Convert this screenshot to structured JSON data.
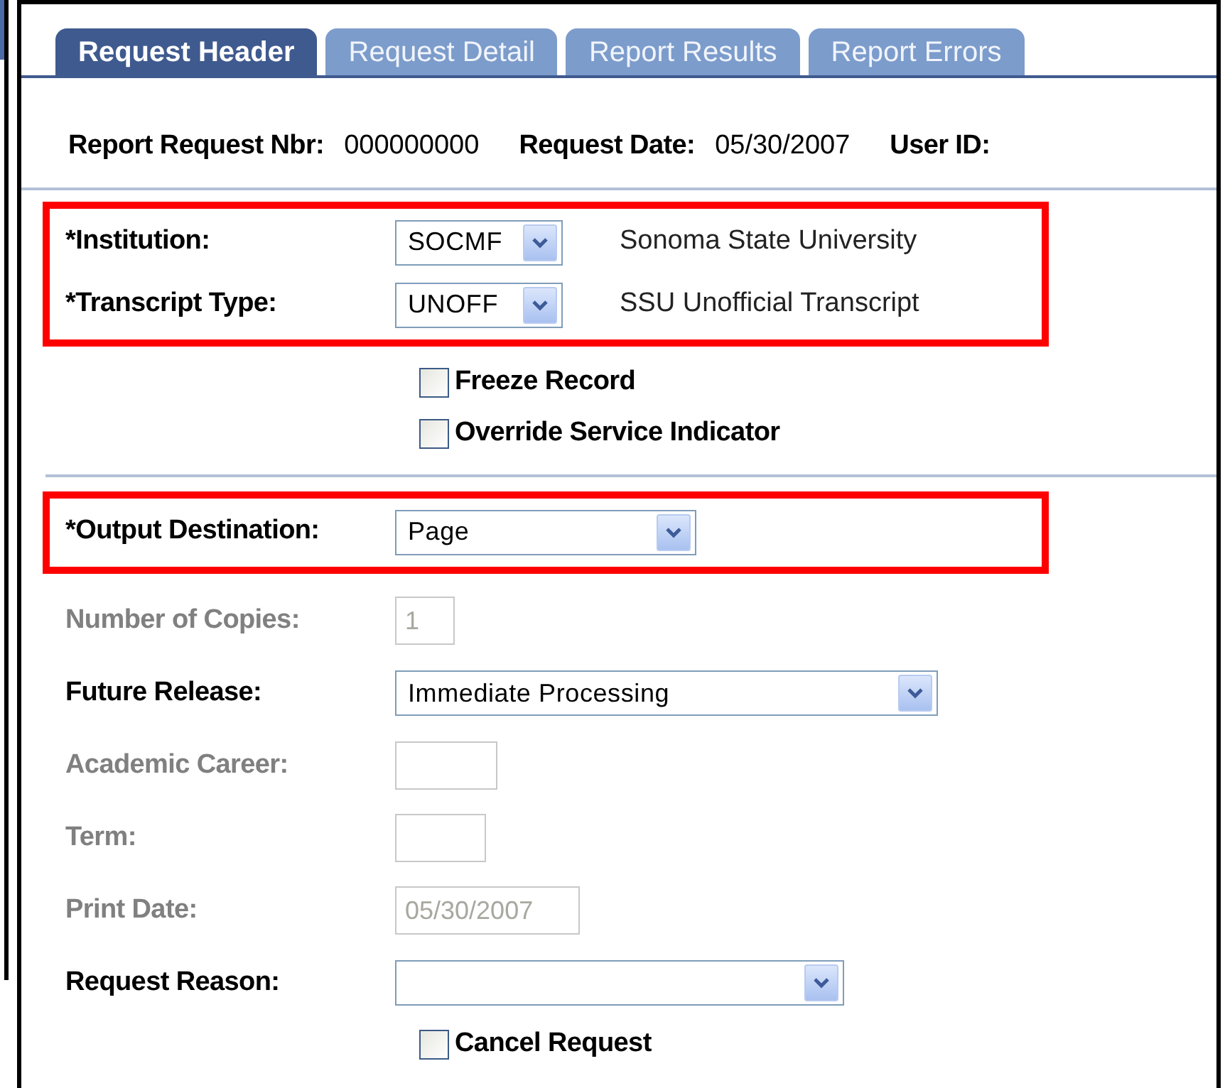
{
  "tabs": [
    {
      "label": "Request Header",
      "selected": true
    },
    {
      "label": "Request Detail",
      "selected": false
    },
    {
      "label": "Report Results",
      "selected": false
    },
    {
      "label": "Report Errors",
      "selected": false
    }
  ],
  "header_info": [
    {
      "label": "Report Request Nbr:",
      "value": "000000000"
    },
    {
      "label": "Request Date:",
      "value": "05/30/2007"
    },
    {
      "label": "User ID:"
    }
  ],
  "sections": [
    {
      "highlighted": true,
      "rows": [
        {
          "kind": "select",
          "label": "*Institution:",
          "value": "SOCMF",
          "description": "Sonoma State University"
        },
        {
          "kind": "select",
          "label": "*Transcript Type:",
          "value": "UNOFF",
          "description": "SSU Unofficial Transcript"
        }
      ]
    },
    {
      "rows": [
        {
          "kind": "checkbox",
          "label": "Freeze Record",
          "checked": false
        },
        {
          "kind": "checkbox",
          "label": "Override Service Indicator",
          "checked": false
        }
      ]
    },
    {
      "divider": true,
      "highlighted": true,
      "rows": [
        {
          "kind": "select",
          "label": "*Output Destination:",
          "value": "Page"
        }
      ]
    },
    {
      "rows": [
        {
          "kind": "text",
          "label": "Number of Copies:",
          "value": "1",
          "disabled": true
        },
        {
          "kind": "select",
          "label": "Future Release:",
          "value": "Immediate Processing"
        },
        {
          "kind": "text",
          "label": "Academic Career:",
          "disabled": true
        },
        {
          "kind": "text",
          "label": "Term:",
          "disabled": true
        },
        {
          "kind": "text",
          "label": "Print Date:",
          "value": "05/30/2007",
          "disabled": true
        },
        {
          "kind": "select",
          "label": "Request Reason:"
        },
        {
          "kind": "checkbox",
          "label": "Cancel Request",
          "checked": false
        }
      ]
    }
  ]
}
